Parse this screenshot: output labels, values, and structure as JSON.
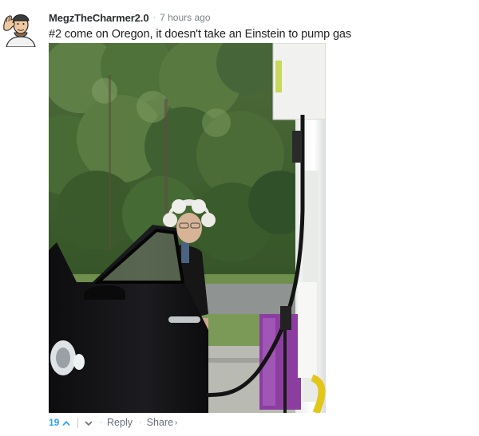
{
  "comment": {
    "username": "MegzTheCharmer2.0",
    "separator": "·",
    "timestamp": "7 hours ago",
    "text": "#2 come on Oregon, it doesn't take an Einstein to pump gas"
  },
  "footer": {
    "vote_count": "19",
    "separator": "·",
    "reply_label": "Reply",
    "share_label": "Share",
    "share_caret": "›"
  },
  "icons": {
    "avatar": "cartoon-avatar-icon",
    "upvote": "chevron-up-icon",
    "downvote": "chevron-down-icon"
  },
  "colors": {
    "vote_accent": "#2e9fff",
    "link_gray": "#656c7a",
    "meta_gray": "#7b8185"
  }
}
